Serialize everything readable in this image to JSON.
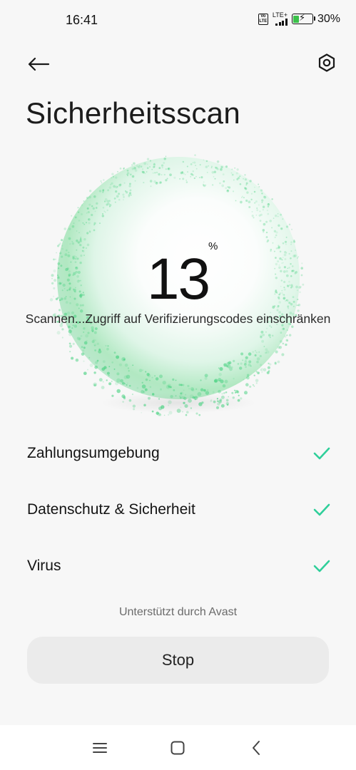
{
  "status_bar": {
    "time": "16:41",
    "volte_label": "Vo LTE",
    "network_label": "LTE+",
    "battery_percent": "30%",
    "battery_level": 0.3,
    "battery_color": "#3bc14a"
  },
  "header": {
    "back_icon": "arrow-left-icon",
    "settings_icon": "gear-icon",
    "title": "Sicherheitsscan"
  },
  "scan": {
    "progress_value": "13",
    "progress_unit": "%",
    "status_text": "Scannen...Zugriff auf Verifizierungscodes einschränken",
    "orb_color": "#3ecf7a"
  },
  "checks": [
    {
      "label": "Zahlungsumgebung",
      "icon": "check-icon",
      "done": true
    },
    {
      "label": "Datenschutz & Sicherheit",
      "icon": "check-icon",
      "done": true
    },
    {
      "label": "Virus",
      "icon": "check-icon",
      "done": true
    }
  ],
  "check_color": "#2fcf9a",
  "footer": {
    "powered_by": "Unterstützt durch Avast",
    "stop_label": "Stop"
  },
  "nav": {
    "menu_icon": "menu-icon",
    "home_icon": "home-icon",
    "back_icon": "back-chevron-icon"
  }
}
